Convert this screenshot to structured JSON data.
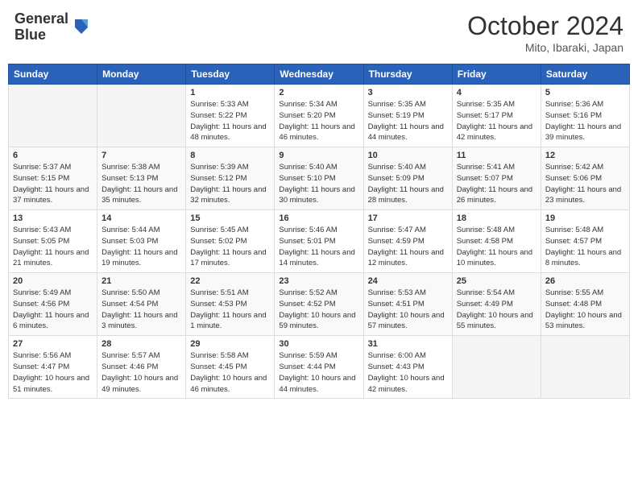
{
  "header": {
    "logo_line1": "General",
    "logo_line2": "Blue",
    "month": "October 2024",
    "location": "Mito, Ibaraki, Japan"
  },
  "weekdays": [
    "Sunday",
    "Monday",
    "Tuesday",
    "Wednesday",
    "Thursday",
    "Friday",
    "Saturday"
  ],
  "weeks": [
    [
      {
        "day": "",
        "info": ""
      },
      {
        "day": "",
        "info": ""
      },
      {
        "day": "1",
        "info": "Sunrise: 5:33 AM\nSunset: 5:22 PM\nDaylight: 11 hours and 48 minutes."
      },
      {
        "day": "2",
        "info": "Sunrise: 5:34 AM\nSunset: 5:20 PM\nDaylight: 11 hours and 46 minutes."
      },
      {
        "day": "3",
        "info": "Sunrise: 5:35 AM\nSunset: 5:19 PM\nDaylight: 11 hours and 44 minutes."
      },
      {
        "day": "4",
        "info": "Sunrise: 5:35 AM\nSunset: 5:17 PM\nDaylight: 11 hours and 42 minutes."
      },
      {
        "day": "5",
        "info": "Sunrise: 5:36 AM\nSunset: 5:16 PM\nDaylight: 11 hours and 39 minutes."
      }
    ],
    [
      {
        "day": "6",
        "info": "Sunrise: 5:37 AM\nSunset: 5:15 PM\nDaylight: 11 hours and 37 minutes."
      },
      {
        "day": "7",
        "info": "Sunrise: 5:38 AM\nSunset: 5:13 PM\nDaylight: 11 hours and 35 minutes."
      },
      {
        "day": "8",
        "info": "Sunrise: 5:39 AM\nSunset: 5:12 PM\nDaylight: 11 hours and 32 minutes."
      },
      {
        "day": "9",
        "info": "Sunrise: 5:40 AM\nSunset: 5:10 PM\nDaylight: 11 hours and 30 minutes."
      },
      {
        "day": "10",
        "info": "Sunrise: 5:40 AM\nSunset: 5:09 PM\nDaylight: 11 hours and 28 minutes."
      },
      {
        "day": "11",
        "info": "Sunrise: 5:41 AM\nSunset: 5:07 PM\nDaylight: 11 hours and 26 minutes."
      },
      {
        "day": "12",
        "info": "Sunrise: 5:42 AM\nSunset: 5:06 PM\nDaylight: 11 hours and 23 minutes."
      }
    ],
    [
      {
        "day": "13",
        "info": "Sunrise: 5:43 AM\nSunset: 5:05 PM\nDaylight: 11 hours and 21 minutes."
      },
      {
        "day": "14",
        "info": "Sunrise: 5:44 AM\nSunset: 5:03 PM\nDaylight: 11 hours and 19 minutes."
      },
      {
        "day": "15",
        "info": "Sunrise: 5:45 AM\nSunset: 5:02 PM\nDaylight: 11 hours and 17 minutes."
      },
      {
        "day": "16",
        "info": "Sunrise: 5:46 AM\nSunset: 5:01 PM\nDaylight: 11 hours and 14 minutes."
      },
      {
        "day": "17",
        "info": "Sunrise: 5:47 AM\nSunset: 4:59 PM\nDaylight: 11 hours and 12 minutes."
      },
      {
        "day": "18",
        "info": "Sunrise: 5:48 AM\nSunset: 4:58 PM\nDaylight: 11 hours and 10 minutes."
      },
      {
        "day": "19",
        "info": "Sunrise: 5:48 AM\nSunset: 4:57 PM\nDaylight: 11 hours and 8 minutes."
      }
    ],
    [
      {
        "day": "20",
        "info": "Sunrise: 5:49 AM\nSunset: 4:56 PM\nDaylight: 11 hours and 6 minutes."
      },
      {
        "day": "21",
        "info": "Sunrise: 5:50 AM\nSunset: 4:54 PM\nDaylight: 11 hours and 3 minutes."
      },
      {
        "day": "22",
        "info": "Sunrise: 5:51 AM\nSunset: 4:53 PM\nDaylight: 11 hours and 1 minute."
      },
      {
        "day": "23",
        "info": "Sunrise: 5:52 AM\nSunset: 4:52 PM\nDaylight: 10 hours and 59 minutes."
      },
      {
        "day": "24",
        "info": "Sunrise: 5:53 AM\nSunset: 4:51 PM\nDaylight: 10 hours and 57 minutes."
      },
      {
        "day": "25",
        "info": "Sunrise: 5:54 AM\nSunset: 4:49 PM\nDaylight: 10 hours and 55 minutes."
      },
      {
        "day": "26",
        "info": "Sunrise: 5:55 AM\nSunset: 4:48 PM\nDaylight: 10 hours and 53 minutes."
      }
    ],
    [
      {
        "day": "27",
        "info": "Sunrise: 5:56 AM\nSunset: 4:47 PM\nDaylight: 10 hours and 51 minutes."
      },
      {
        "day": "28",
        "info": "Sunrise: 5:57 AM\nSunset: 4:46 PM\nDaylight: 10 hours and 49 minutes."
      },
      {
        "day": "29",
        "info": "Sunrise: 5:58 AM\nSunset: 4:45 PM\nDaylight: 10 hours and 46 minutes."
      },
      {
        "day": "30",
        "info": "Sunrise: 5:59 AM\nSunset: 4:44 PM\nDaylight: 10 hours and 44 minutes."
      },
      {
        "day": "31",
        "info": "Sunrise: 6:00 AM\nSunset: 4:43 PM\nDaylight: 10 hours and 42 minutes."
      },
      {
        "day": "",
        "info": ""
      },
      {
        "day": "",
        "info": ""
      }
    ]
  ]
}
